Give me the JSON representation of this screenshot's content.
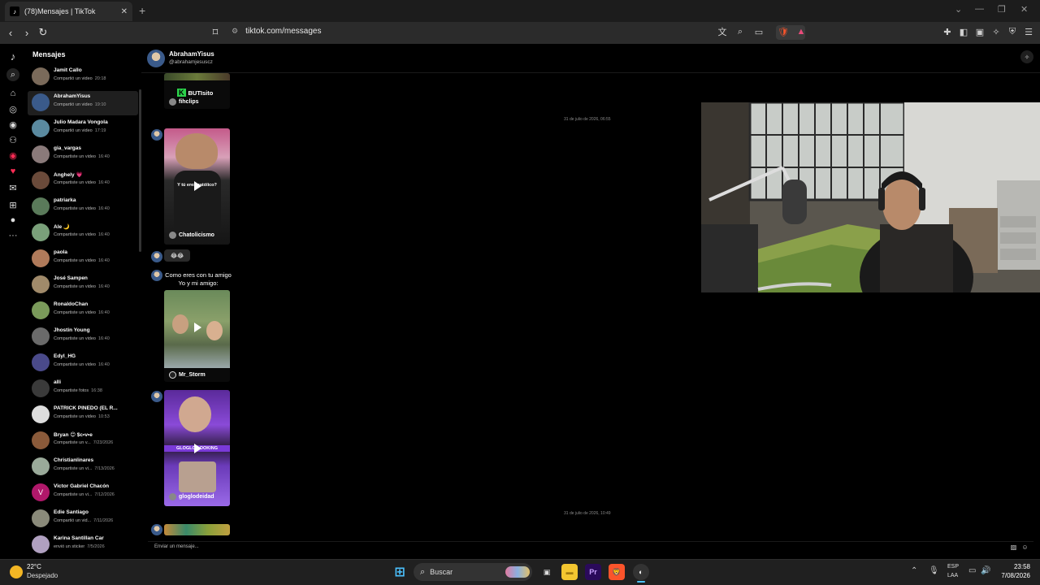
{
  "browser": {
    "tab_title": "(78)Mensajes | TikTok",
    "tab_close": "✕",
    "new_tab": "+",
    "url": "tiktok.com/messages"
  },
  "tiktok": {
    "inbox_title": "Mensajes",
    "conversations": [
      {
        "name": "Jamit Callo",
        "message": "Compartió un video",
        "time": "20:18",
        "color": "#7a6a5a"
      },
      {
        "name": "AbrahamYisus",
        "message": "Compartió un video",
        "time": "19:10",
        "color": "#3a5a8a",
        "active": true
      },
      {
        "name": "Julio Madara Vongola",
        "message": "Compartió un video",
        "time": "17:19",
        "color": "#5a8aa0"
      },
      {
        "name": "gia_vargas",
        "message": "Compartiste un video",
        "time": "16:40",
        "color": "#8a7a7a"
      },
      {
        "name": "Anghely 💗",
        "message": "Compartiste un video",
        "time": "16:40",
        "color": "#6a4a3a"
      },
      {
        "name": "patriarka",
        "message": "Compartiste un video",
        "time": "16:40",
        "color": "#5a7a5a"
      },
      {
        "name": "Ale 🌙",
        "message": "Compartiste un video",
        "time": "16:40",
        "color": "#7aa07a"
      },
      {
        "name": "paola",
        "message": "Compartiste un video",
        "time": "16:40",
        "color": "#b07a5a"
      },
      {
        "name": "José Sampen",
        "message": "Compartiste un video",
        "time": "16:40",
        "color": "#a08a6a"
      },
      {
        "name": "RonaldoChan",
        "message": "Compartiste un video",
        "time": "16:40",
        "color": "#7a9a5a"
      },
      {
        "name": "Jhostin Young",
        "message": "Compartiste un video",
        "time": "16:40",
        "color": "#6a6a6a"
      },
      {
        "name": "Edyl_HG",
        "message": "Compartiste un video",
        "time": "16:40",
        "color": "#4a4a8a"
      },
      {
        "name": "alli",
        "message": "Compartiste fotos",
        "time": "16:38",
        "color": "#3a3a3a"
      },
      {
        "name": "PATRICK PINEDO (EL R...",
        "message": "Compartiste un video",
        "time": "10:53",
        "color": "#dddddd"
      },
      {
        "name": "Bryan 😊 $c•v•e",
        "message": "Compartiste un v...",
        "time": "7/23/2026",
        "color": "#8a5a3a"
      },
      {
        "name": "Christianlinares",
        "message": "Compartiste un vi...",
        "time": "7/13/2026",
        "color": "#9aaa9a"
      },
      {
        "name": "Victor Gabriel Chacón",
        "message": "Compartiste un vi...",
        "time": "7/12/2026",
        "color": "#b0186a",
        "initial": "V"
      },
      {
        "name": "Edie Santiago",
        "message": "Compartió un vid...",
        "time": "7/11/2026",
        "color": "#8a8a7a"
      },
      {
        "name": "Karina Santillan Car",
        "message": "envió un sticker",
        "time": "7/5/2026",
        "color": "#b0a0c0"
      }
    ],
    "chat": {
      "name": "AbrahamYisus",
      "handle": "@abrahamjesuscz",
      "settings_icon": "sparkle-icon",
      "date1": "31 de julio de 2026, 06:55",
      "date2": "31 de julio de 2026, 10:49",
      "video1_caption": "BUTIsito",
      "video1_user": "fihclips",
      "video2_overlay": "Y tú eres católico?",
      "video2_user": "Chatolicismo",
      "emoji_reply": "😂😂",
      "text_message": "Como eres con tu amigo Yo y mi amigo:",
      "video3_user": "Mr_Storm",
      "video4_overlay": "GLOGLO LOOKING",
      "video4_user": "gloglodeidad",
      "composer_placeholder": "Enviar un mensaje..."
    }
  },
  "taskbar": {
    "weather_temp": "22°C",
    "weather_desc": "Despejado",
    "search_placeholder": "Buscar",
    "lang_line1": "ESP",
    "lang_line2": "LAA",
    "time": "23:58",
    "date": "7/08/2026",
    "premiere_label": "Pr"
  }
}
